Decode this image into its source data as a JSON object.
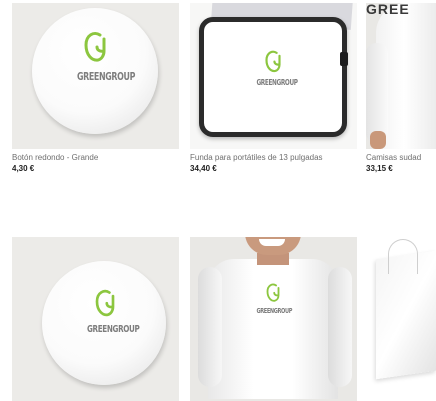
{
  "products": [
    {
      "title": "Botón redondo - Grande",
      "price": "4,30 €",
      "logo_text": "GREENGROUP"
    },
    {
      "title": "Funda para portátiles de 13 pulgadas",
      "price": "34,40 €",
      "logo_text": "GREENGROUP"
    },
    {
      "title": "Camisas sudad",
      "price": "33,15 €",
      "partial_text": "GREE"
    },
    {
      "title": "",
      "price": "",
      "logo_text": "GREENGROUP"
    },
    {
      "title": "",
      "price": "",
      "logo_text": "GREENGROUP"
    },
    {
      "title": "",
      "price": ""
    }
  ],
  "colors": {
    "logo_green": "#8cc63f",
    "price_text": "#222222",
    "title_text": "#6f6f6f"
  },
  "icons": {
    "logo_mark": "greengroup-g-logo-icon"
  }
}
